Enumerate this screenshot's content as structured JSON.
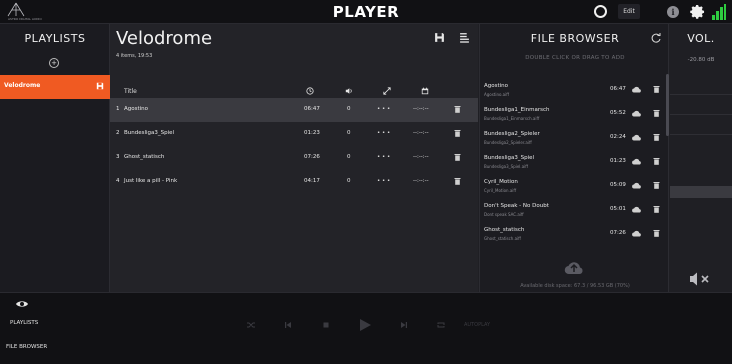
{
  "app": {
    "title": "PLAYER",
    "logo_text": "ASTRO DIGITAL AUDIO",
    "edit_label": "Edit"
  },
  "colors": {
    "accent": "#f05a22",
    "signal": "#2ecc40"
  },
  "sidebar": {
    "header": "PLAYLISTS",
    "items": [
      {
        "label": "Velodrome"
      }
    ]
  },
  "playlist": {
    "title": "Velodrome",
    "meta": "4 items, 19:53",
    "columns": {
      "title": "Title"
    },
    "rows": [
      {
        "index": "1",
        "title": "Agostino",
        "duration": "06:47",
        "gain": "0",
        "fades": "• • •",
        "schedule": "--:--:--"
      },
      {
        "index": "2",
        "title": "Bundesliga3_Spiel",
        "duration": "01:23",
        "gain": "0",
        "fades": "• • •",
        "schedule": "--:--:--"
      },
      {
        "index": "3",
        "title": "Ghost_statisch",
        "duration": "07:26",
        "gain": "0",
        "fades": "• • •",
        "schedule": "--:--:--"
      },
      {
        "index": "4",
        "title": "Just like a pill - Pink",
        "duration": "04:17",
        "gain": "0",
        "fades": "• • •",
        "schedule": "--:--:--"
      }
    ]
  },
  "file_browser": {
    "header": "FILE BROWSER",
    "hint": "DOUBLE CLICK OR DRAG TO ADD",
    "disk": "Available disk space: 67.3 / 96.53 GB (70%)",
    "files": [
      {
        "name": "Agostino",
        "file": "Agostino.aiff",
        "duration": "06:47"
      },
      {
        "name": "Bundesliga1_Einmarsch",
        "file": "Bundesliga1_Einmarsch.aiff",
        "duration": "05:52"
      },
      {
        "name": "Bundesliga2_Spieler",
        "file": "Bundesliga2_Spieler.aiff",
        "duration": "02:24"
      },
      {
        "name": "Bundesliga3_Spiel",
        "file": "Bundesliga3_Spiel.aiff",
        "duration": "01:23"
      },
      {
        "name": "Cyril_Motion",
        "file": "Cyril_Motion.aiff",
        "duration": "05:09"
      },
      {
        "name": "Don't Speak - No Doubt",
        "file": "Dont speak SAC.aiff",
        "duration": "05:01"
      },
      {
        "name": "Ghost_statisch",
        "file": "Ghost_statisch.aiff",
        "duration": "07:26"
      }
    ]
  },
  "volume": {
    "header": "VOL.",
    "db": "-20.80 dB",
    "level": 0.38
  },
  "bottom_nav": {
    "playlists": "PLAYLISTS",
    "file_browser": "FILE BROWSER",
    "autoplay": "AUTOPLAY"
  }
}
